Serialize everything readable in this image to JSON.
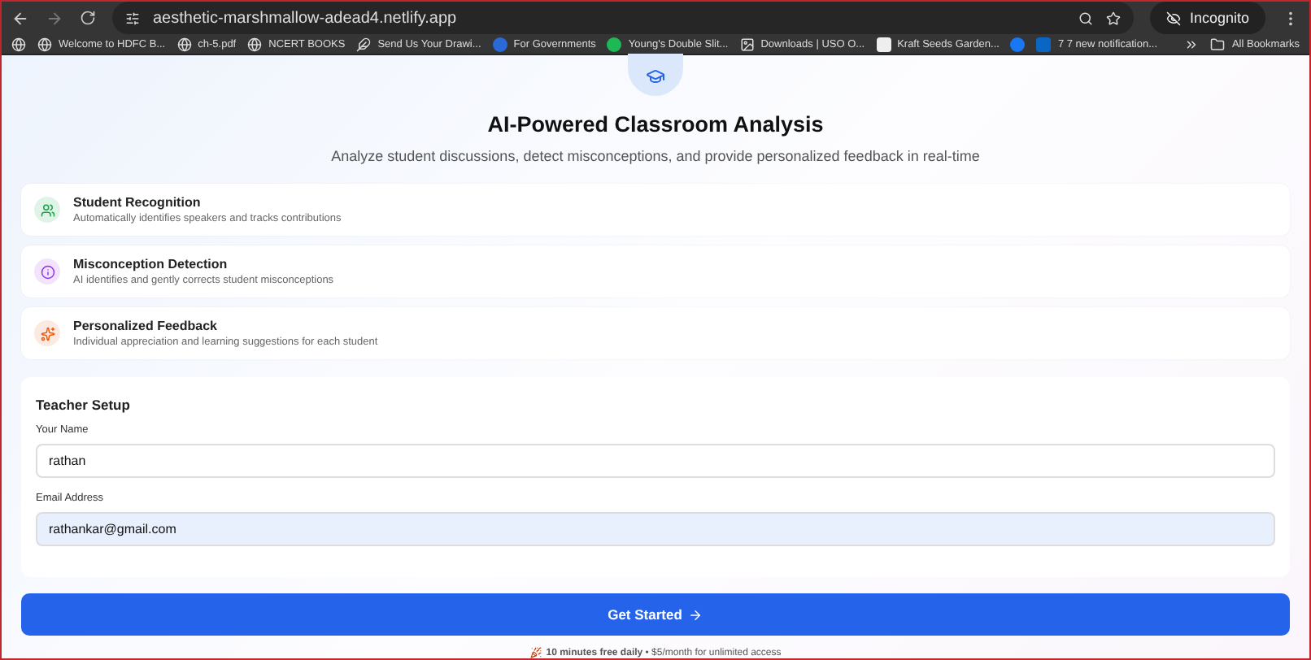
{
  "browser": {
    "url": "aesthetic-marshmallow-adead4.netlify.app",
    "profile": "Incognito",
    "bookmarks": [
      {
        "label": "Welcome to HDFC B...",
        "kind": "globe"
      },
      {
        "label": "ch-5.pdf",
        "kind": "globe"
      },
      {
        "label": "NCERT BOOKS",
        "kind": "globe"
      },
      {
        "label": "Send Us Your Drawi...",
        "kind": "feather"
      },
      {
        "label": "For Governments",
        "kind": "blue"
      },
      {
        "label": "Young's Double Slit...",
        "kind": "green"
      },
      {
        "label": "Downloads | USO O...",
        "kind": "image"
      },
      {
        "label": "Kraft Seeds Garden...",
        "kind": "box"
      },
      {
        "kind": "facebook"
      },
      {
        "label": "7 7 new notification...",
        "kind": "linkedin"
      }
    ],
    "all_bookmarks": "All Bookmarks"
  },
  "hero": {
    "title": "AI-Powered Classroom Analysis",
    "subtitle": "Analyze student discussions, detect misconceptions, and provide personalized feedback in real-time"
  },
  "features": [
    {
      "title": "Student Recognition",
      "text": "Automatically identifies speakers and tracks contributions",
      "color": "#16a34a",
      "kind": "users"
    },
    {
      "title": "Misconception Detection",
      "text": "AI identifies and gently corrects student misconceptions",
      "color": "#9333ea",
      "kind": "info"
    },
    {
      "title": "Personalized Feedback",
      "text": "Individual appreciation and learning suggestions for each student",
      "color": "#ea580c",
      "kind": "sparkle"
    }
  ],
  "setup": {
    "title": "Teacher Setup",
    "fields": [
      {
        "label": "Your Name",
        "value": "rathan",
        "autofilled": false
      },
      {
        "label": "Email Address",
        "value": "rathankar@gmail.com",
        "autofilled": true
      }
    ]
  },
  "cta": "Get Started",
  "footer": "**10 minutes free daily** • $5/month for unlimited access"
}
